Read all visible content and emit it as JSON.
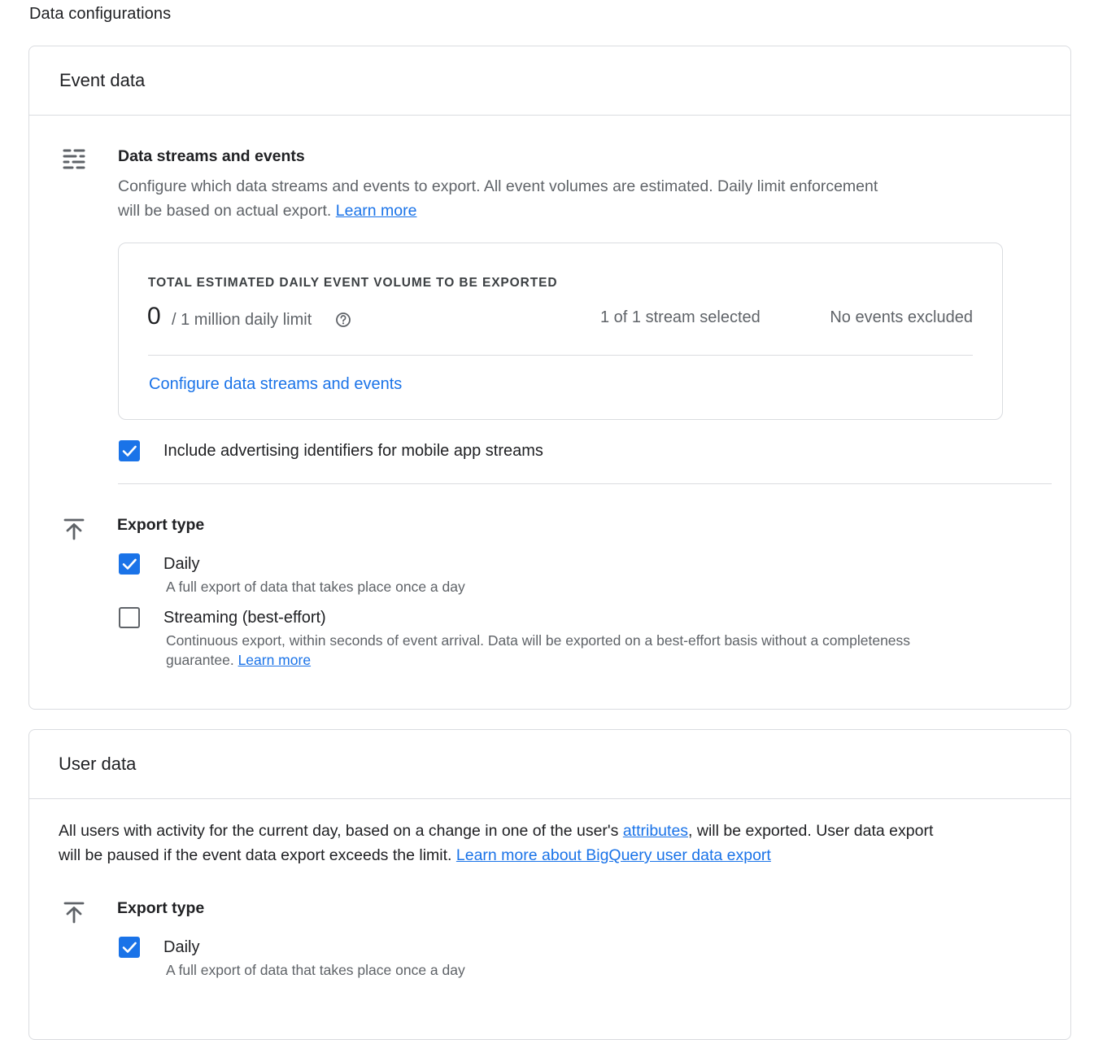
{
  "page": {
    "heading": "Data configurations"
  },
  "event_data": {
    "title": "Event data",
    "streams": {
      "icon": "tune-icon",
      "title": "Data streams and events",
      "description": "Configure which data streams and events to export. All event volumes are estimated. Daily limit enforcement will be based on actual export.",
      "learn_more": "Learn more"
    },
    "volume": {
      "label": "TOTAL ESTIMATED DAILY EVENT VOLUME TO BE EXPORTED",
      "count": "0",
      "limit": "/ 1 million daily limit",
      "streams_selected": "1 of 1 stream selected",
      "events_excluded": "No events excluded",
      "configure_link": "Configure data streams and events"
    },
    "advertising_ids": {
      "label": "Include advertising identifiers for mobile app streams",
      "checked": true
    },
    "export_type": {
      "icon": "upload-icon",
      "title": "Export type",
      "daily": {
        "label": "Daily",
        "description": "A full export of data that takes place once a day",
        "checked": true
      },
      "streaming": {
        "label": "Streaming (best-effort)",
        "description_line1": "Continuous export, within seconds of event arrival. Data will be exported on a best-effort basis without a completeness",
        "description_line2": "guarantee.",
        "learn_more": "Learn more",
        "checked": false
      }
    }
  },
  "user_data": {
    "title": "User data",
    "description_part1": "All users with activity for the current day, based on a change in one of the user's",
    "attributes_link": "attributes",
    "description_part2": ", will be exported. User data export",
    "description_part3": "will be paused if the event data export exceeds the limit.",
    "learn_more": "Learn more about BigQuery user data export",
    "export_type": {
      "icon": "upload-icon",
      "title": "Export type",
      "daily": {
        "label": "Daily",
        "description": "A full export of data that takes place once a day",
        "checked": true
      }
    }
  },
  "colors": {
    "accent": "#1a73e8",
    "border": "#dadce0",
    "text": "#202124",
    "secondary_text": "#5f6368"
  }
}
